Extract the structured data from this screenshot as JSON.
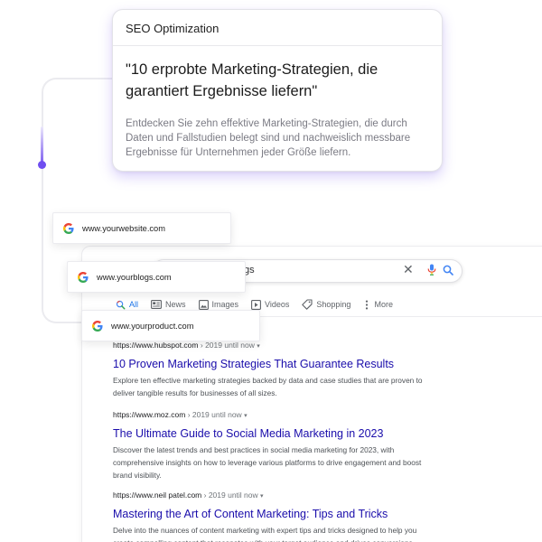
{
  "seo_card": {
    "header": "SEO Optimization",
    "title": "\"10 erprobte Marketing-Strategien, die garantiert Ergebnisse liefern\"",
    "description": "Entdecken Sie zehn effektive Marketing-Strategien, die durch Daten und Fallstudien belegt sind und nachweislich messbare Ergebnisse für Unternehmen jeder Größe liefern."
  },
  "url_cards": [
    {
      "url": "www.yourwebsite.com",
      "icon": "google-g-icon"
    },
    {
      "url": "www.yourblogs.com",
      "icon": "google-g-icon"
    },
    {
      "url": "www.yourproduct.com",
      "icon": "google-g-icon"
    }
  ],
  "search": {
    "query_visible": "gs",
    "icons": [
      "clear-icon",
      "mic-icon",
      "lens-icon"
    ]
  },
  "tabs": [
    {
      "label": "All",
      "icon": "search-icon",
      "active": true
    },
    {
      "label": "News",
      "icon": "news-icon"
    },
    {
      "label": "Images",
      "icon": "image-icon"
    },
    {
      "label": "Videos",
      "icon": "play-icon"
    },
    {
      "label": "Shopping",
      "icon": "tag-icon"
    },
    {
      "label": "More",
      "icon": "more-vert-icon"
    }
  ],
  "results": [
    {
      "url": "https://www.hubspot.com",
      "meta": "› 2019 until now",
      "title": "10 Proven Marketing Strategies That Guarantee Results",
      "snippet": "Explore ten effective marketing strategies backed by data and case studies that are proven to deliver tangible results for businesses of all sizes."
    },
    {
      "url": "https://www.moz.com",
      "meta": "› 2019 until now",
      "title": "The Ultimate Guide to Social Media Marketing in 2023",
      "snippet": "Discover the latest trends and best practices in social media marketing for 2023, with comprehensive insights on how to leverage various platforms to drive engagement and boost brand visibility."
    },
    {
      "url": "https://www.neil patel.com",
      "meta": "› 2019 until now",
      "title": "Mastering the Art of Content Marketing: Tips and Tricks",
      "snippet": "Delve into the nuances of content marketing with expert tips and tricks designed to help you create compelling content that resonates with your target audience and drives conversions."
    }
  ],
  "colors": {
    "accent": "#6f4ef0",
    "link": "#1a0dab",
    "active_tab": "#1a73e8"
  }
}
